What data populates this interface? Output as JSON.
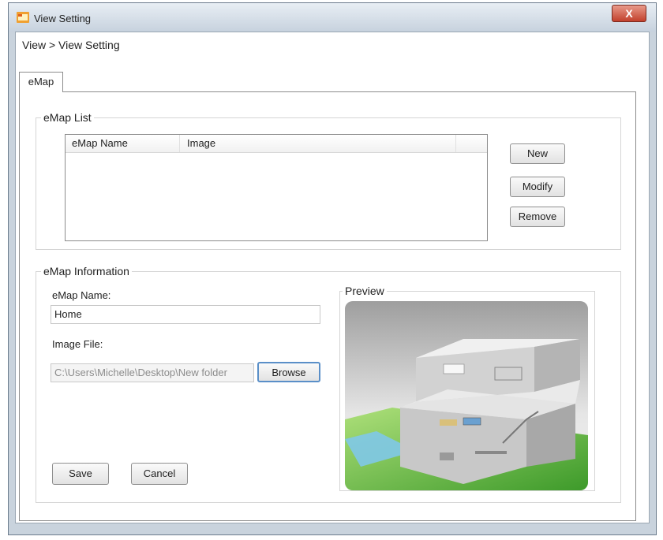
{
  "window": {
    "title": "View Setting",
    "close_label": "X"
  },
  "breadcrumb": "View > View Setting",
  "tabs": [
    {
      "label": "eMap"
    }
  ],
  "emap_list": {
    "group_label": "eMap List",
    "columns": [
      "eMap Name",
      "Image"
    ],
    "rows": [],
    "buttons": {
      "new": "New",
      "modify": "Modify",
      "remove": "Remove"
    }
  },
  "emap_information": {
    "group_label": "eMap Information",
    "name_label": "eMap Name:",
    "name_value": "Home",
    "image_label": "Image File:",
    "image_value": "C:\\Users\\Michelle\\Desktop\\New folder",
    "browse_label": "Browse",
    "preview_label": "Preview",
    "save_label": "Save",
    "cancel_label": "Cancel"
  },
  "icons": {
    "app": "app-window-icon",
    "close": "close-icon"
  }
}
